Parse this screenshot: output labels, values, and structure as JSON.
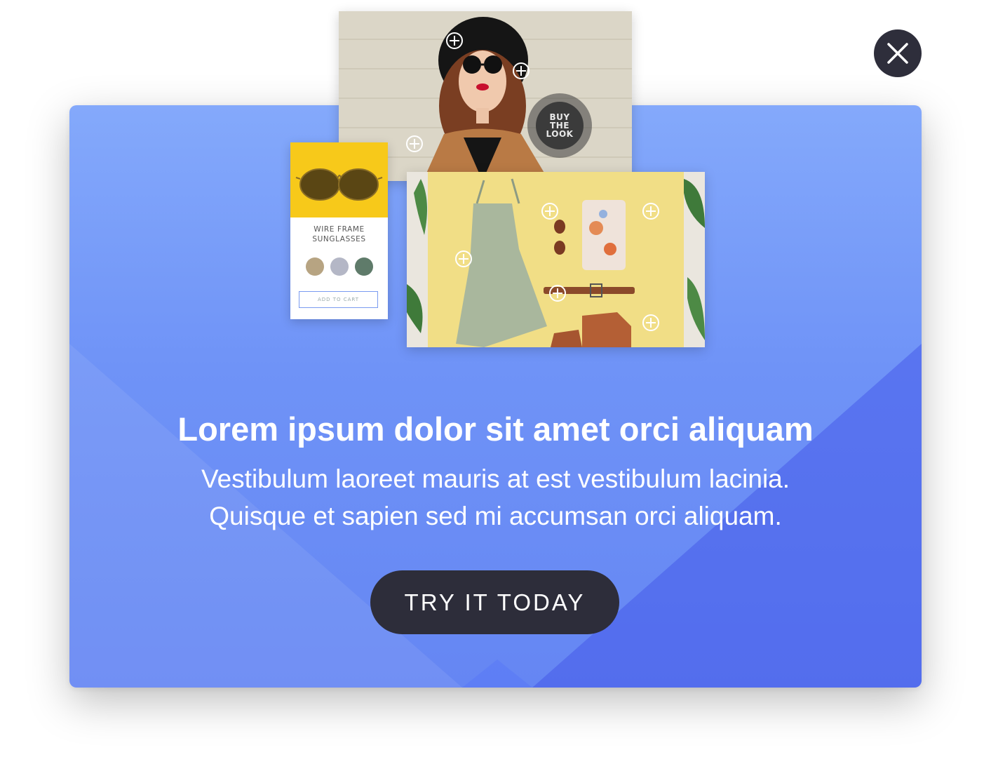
{
  "modal": {
    "close_label": "close",
    "headline": "Lorem ipsum dolor sit amet orci aliquam",
    "subtext_line1": "Vestibulum laoreet mauris at est vestibulum lacinia.",
    "subtext_line2": "Quisque et sapien sed mi accumsan orci aliquam.",
    "cta_label": "TRY IT TODAY"
  },
  "collage": {
    "buy_the_look": [
      "BUY",
      "THE",
      "LOOK"
    ],
    "product_card": {
      "name_line1": "WIRE FRAME",
      "name_line2": "SUNGLASSES",
      "swatch_colors": [
        "#b7a482",
        "#b4b7c6",
        "#5f7b6a"
      ],
      "add_to_cart_label": "ADD TO CART"
    }
  },
  "colors": {
    "modal_gradient_top": "#84a9fb",
    "modal_gradient_bottom": "#6586f3",
    "accent_dark": "#2d2d3a",
    "card_yellow": "#f7c91a"
  }
}
